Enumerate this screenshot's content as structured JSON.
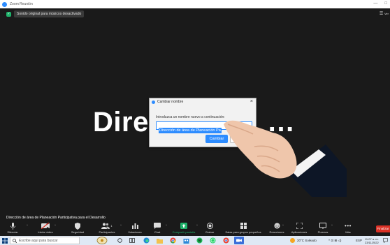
{
  "window": {
    "title": "Zoom Reunión",
    "minimize": "—",
    "maximize": "□"
  },
  "meeting": {
    "original_sound_label": "Sonido original para músicos desactivado",
    "view_button": "Ver",
    "participant_display_name": "Direc",
    "participant_name_suffix": "…",
    "caption": "Dirección de área de Planeación Participativa para el Desarrollo"
  },
  "rename_dialog": {
    "title": "Cambiar nombre",
    "close": "×",
    "prompt": "Introduzca un nombre nuevo a continuación:",
    "input_value": "Dirección de área de Planeación Pa",
    "primary_button": "Cambiar",
    "cancel_button": "Ca"
  },
  "toolbar": {
    "items": [
      {
        "label": "Silenciar",
        "icon": "microphone-icon"
      },
      {
        "label": "Iniciar video",
        "icon": "video-off-icon"
      },
      {
        "label": "Seguridad",
        "icon": "shield-icon"
      },
      {
        "label": "Participantes",
        "icon": "participants-icon",
        "count": "1"
      },
      {
        "label": "Votaciones",
        "icon": "polls-icon"
      },
      {
        "label": "Chat",
        "icon": "chat-icon"
      },
      {
        "label": "Compartir pantalla",
        "icon": "share-screen-icon"
      },
      {
        "label": "Grabar",
        "icon": "record-icon"
      },
      {
        "label": "Salas para grupos pequeños",
        "icon": "breakout-rooms-icon"
      },
      {
        "label": "Reacciones",
        "icon": "reactions-icon"
      },
      {
        "label": "Aplicaciones",
        "icon": "apps-icon"
      },
      {
        "label": "Pizarras",
        "icon": "whiteboard-icon"
      },
      {
        "label": "Más",
        "icon": "more-icon"
      }
    ],
    "end_button": "Finalizar",
    "caret": "^"
  },
  "taskbar": {
    "search_placeholder": "Escribe aquí para buscar",
    "weather": "20°C  Soleado",
    "language": "ESP",
    "time": "11:07 a. m.",
    "date": "23/11/2022",
    "tray_icons": "^ ⊡ ⊞ ◁)"
  },
  "colors": {
    "zoom_blue": "#2d8cff",
    "end_red": "#d93025",
    "share_green": "#1fb36b",
    "stage_bg": "#1a1a1a",
    "taskbar_bg": "#dfe9f5"
  }
}
